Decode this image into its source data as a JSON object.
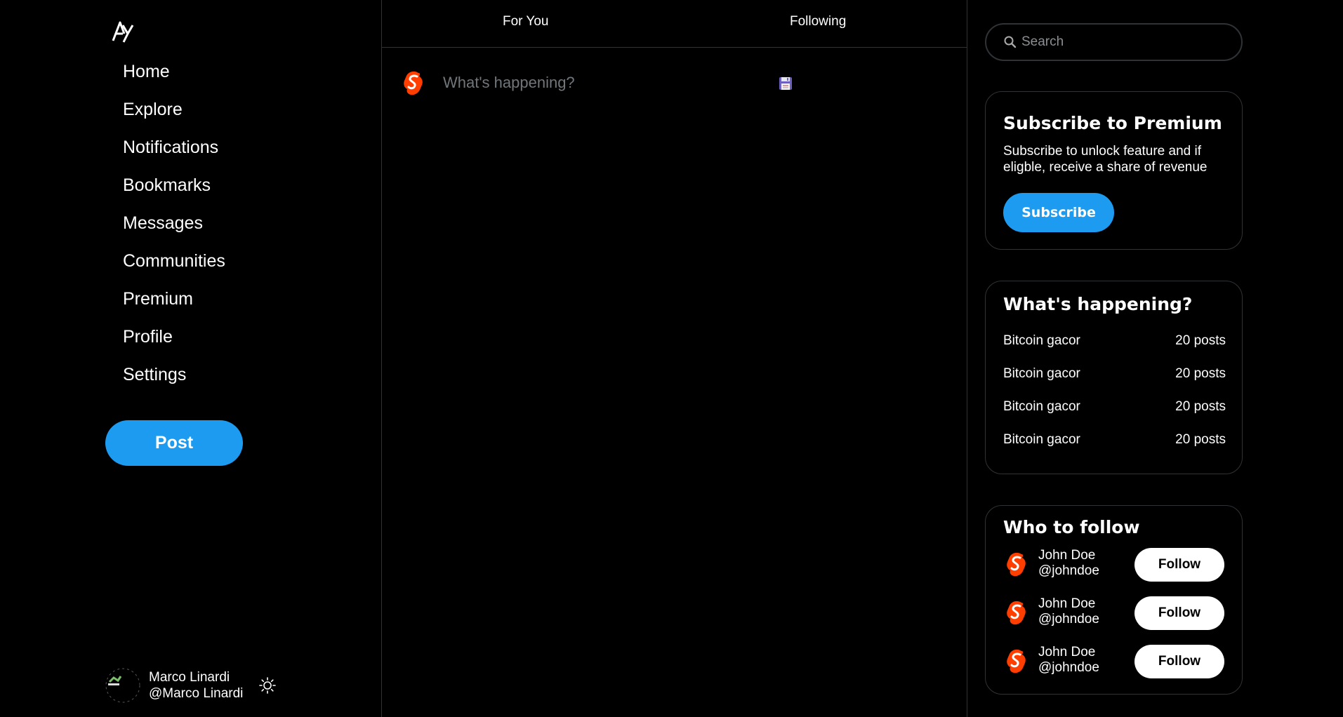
{
  "sidebar": {
    "logo_icon": "ay-logo-icon",
    "nav": [
      {
        "label": "Home"
      },
      {
        "label": "Explore"
      },
      {
        "label": "Notifications"
      },
      {
        "label": "Bookmarks"
      },
      {
        "label": "Messages"
      },
      {
        "label": "Communities"
      },
      {
        "label": "Premium"
      },
      {
        "label": "Profile"
      },
      {
        "label": "Settings"
      }
    ],
    "post_label": "Post",
    "user": {
      "name": "Marco Linardi",
      "handle": "@Marco Linardi"
    },
    "theme_icon": "sun-icon"
  },
  "feed": {
    "tabs": [
      {
        "label": "For You"
      },
      {
        "label": "Following"
      }
    ],
    "composer": {
      "placeholder": "What's happening?",
      "save_icon": "floppy-disk-icon"
    }
  },
  "right": {
    "search": {
      "placeholder": "Search"
    },
    "premium": {
      "title": "Subscribe to Premium",
      "description": "Subscribe to unlock feature and if eligble, receive a share of revenue",
      "button": "Subscribe"
    },
    "trends": {
      "title": "What's happening?",
      "items": [
        {
          "topic": "Bitcoin gacor",
          "count": "20 posts"
        },
        {
          "topic": "Bitcoin gacor",
          "count": "20 posts"
        },
        {
          "topic": "Bitcoin gacor",
          "count": "20 posts"
        },
        {
          "topic": "Bitcoin gacor",
          "count": "20 posts"
        }
      ]
    },
    "who_to_follow": {
      "title": "Who to follow",
      "users": [
        {
          "name": "John Doe",
          "handle": "@johndoe",
          "button": "Follow"
        },
        {
          "name": "John Doe",
          "handle": "@johndoe",
          "button": "Follow"
        },
        {
          "name": "John Doe",
          "handle": "@johndoe",
          "button": "Follow"
        }
      ]
    }
  },
  "colors": {
    "background": "#000000",
    "accent": "#1d9bf0",
    "border": "#2f3336",
    "svelte_orange": "#ff3e00"
  }
}
